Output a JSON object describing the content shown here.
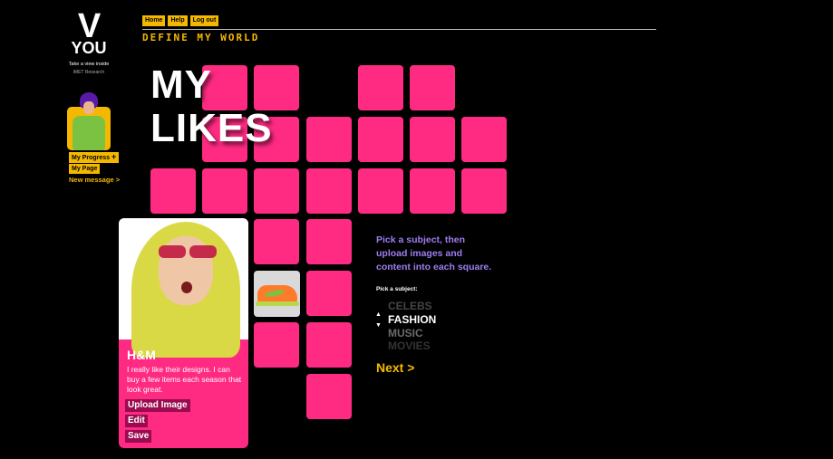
{
  "logo": {
    "letter": "V",
    "word": "YOU",
    "tagline": "Take a view inside",
    "lab": "iMET Research"
  },
  "left": {
    "my_progress": "My Progress",
    "progress_plus": "+",
    "my_page": "My Page",
    "new_message": "New message >"
  },
  "nav": {
    "home": "Home",
    "help": "Help",
    "logout": "Log out"
  },
  "banner": "DEFINE MY WORLD",
  "heading": {
    "line1": "MY",
    "line2": "LIKES"
  },
  "card": {
    "title": "H&M",
    "description": "I really like their designs. I can buy a few items each season that look great.",
    "upload": "Upload Image",
    "edit": "Edit",
    "save": "Save"
  },
  "panel": {
    "instruction": "Pick a subject, then upload images and content into each square.",
    "pick_label": "Pick a subject:",
    "arrow_up": "▲",
    "arrow_down": "▼",
    "subjects": [
      "CELEBS",
      "FASHION",
      "MUSIC",
      "MOVIES"
    ],
    "selected_subject": "FASHION",
    "next": "Next >"
  },
  "colors": {
    "accent_yellow": "#f5b800",
    "pink": "#ff2a82",
    "instruction_purple": "#9d7df0",
    "button_dark": "#9a0b4f"
  }
}
